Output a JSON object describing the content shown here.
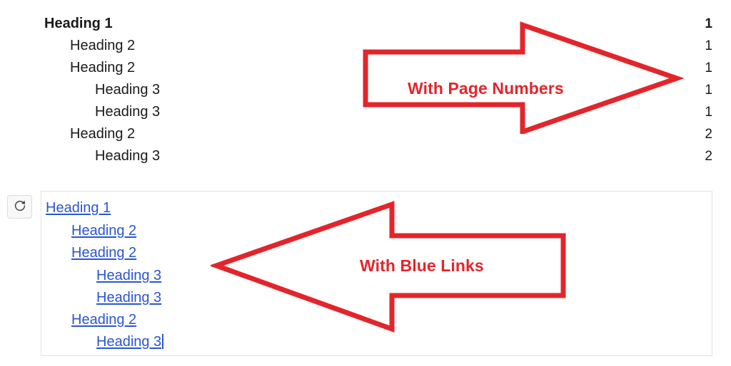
{
  "top_section": {
    "name": "table-of-contents-with-page-numbers",
    "entries": [
      {
        "title": "Heading 1",
        "level": 0,
        "page": "1",
        "bold": true
      },
      {
        "title": "Heading 2",
        "level": 1,
        "page": "1",
        "bold": false
      },
      {
        "title": "Heading 2",
        "level": 1,
        "page": "1",
        "bold": false
      },
      {
        "title": "Heading 3",
        "level": 2,
        "page": "1",
        "bold": false
      },
      {
        "title": "Heading 3",
        "level": 2,
        "page": "1",
        "bold": false
      },
      {
        "title": "Heading 2",
        "level": 1,
        "page": "2",
        "bold": false
      },
      {
        "title": "Heading 3",
        "level": 2,
        "page": "2",
        "bold": false
      }
    ]
  },
  "bottom_section": {
    "name": "table-of-contents-with-blue-links",
    "refresh_button": {
      "icon": "refresh-icon",
      "label": ""
    },
    "entries": [
      {
        "title": "Heading 1",
        "level": 0
      },
      {
        "title": "Heading 2",
        "level": 1
      },
      {
        "title": "Heading 2",
        "level": 1
      },
      {
        "title": "Heading 3",
        "level": 2
      },
      {
        "title": "Heading 3",
        "level": 2
      },
      {
        "title": "Heading 2",
        "level": 1
      },
      {
        "title": "Heading 3",
        "level": 2
      }
    ],
    "caret_after_entry_index": 6
  },
  "annotations": {
    "page_numbers_arrow": {
      "label": "With Page Numbers",
      "direction": "right",
      "color": "#e3252b"
    },
    "blue_links_arrow": {
      "label": "With Blue Links",
      "direction": "left",
      "color": "#e3252b"
    }
  },
  "colors": {
    "annotation_red": "#e3252b",
    "link_blue": "#2a55d4",
    "text_black": "#1a1a1a",
    "panel_border": "#e3e3e3",
    "button_background": "#f8f8f8"
  }
}
